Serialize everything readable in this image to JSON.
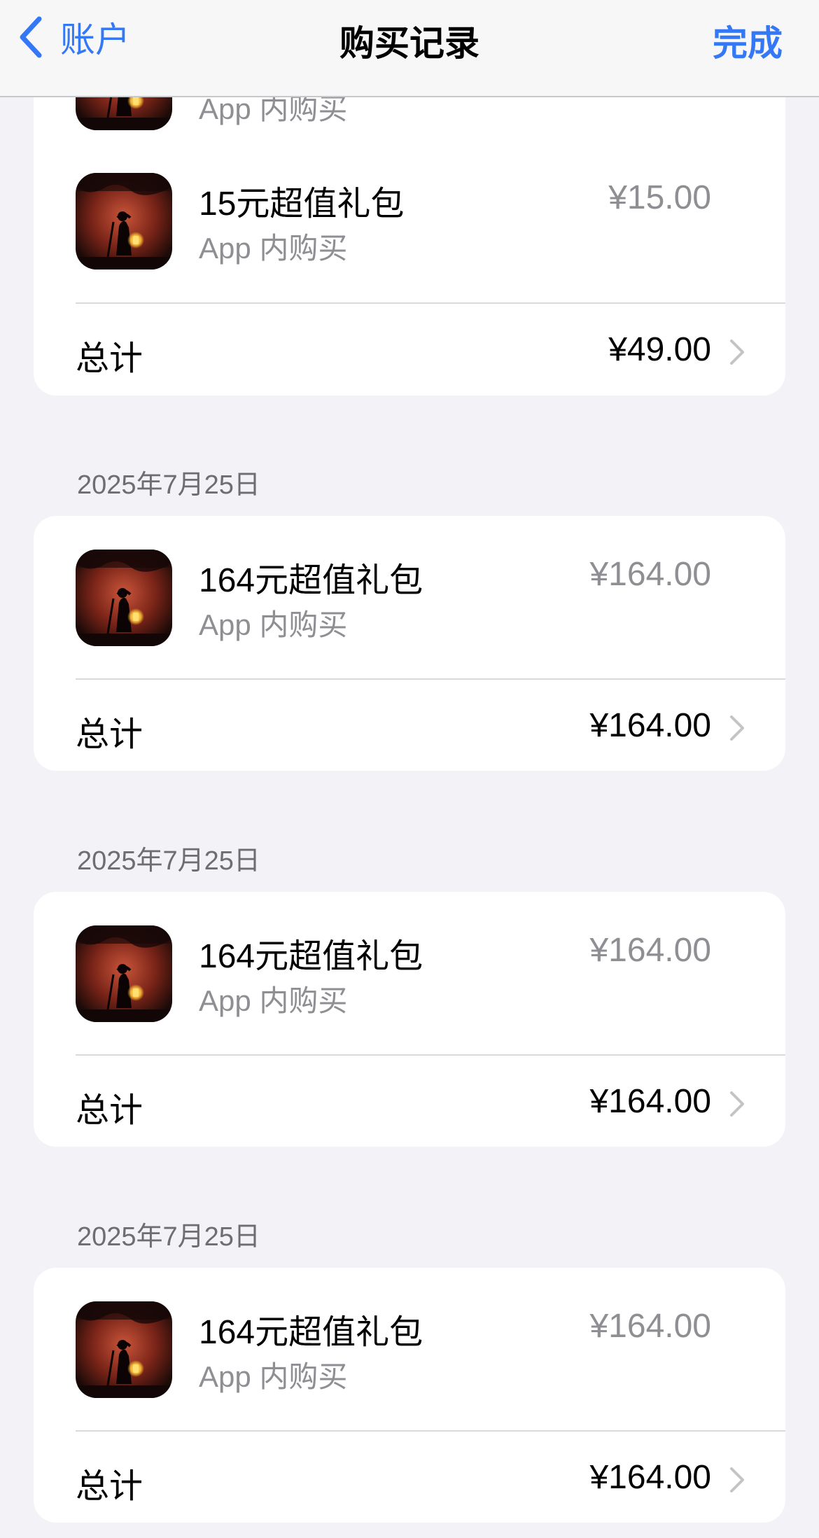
{
  "nav": {
    "back_label": "账户",
    "title": "购买记录",
    "done_label": "完成"
  },
  "group1": {
    "partial_item": {
      "subtitle": "App 内购买"
    },
    "item": {
      "title": "15元超值礼包",
      "subtitle": "App 内购买",
      "price": "¥15.00"
    },
    "total_label": "总计",
    "total_value": "¥49.00"
  },
  "group2": {
    "date": "2025年7月25日",
    "item": {
      "title": "164元超值礼包",
      "subtitle": "App 内购买",
      "price": "¥164.00"
    },
    "total_label": "总计",
    "total_value": "¥164.00"
  },
  "group3": {
    "date": "2025年7月25日",
    "item": {
      "title": "164元超值礼包",
      "subtitle": "App 内购买",
      "price": "¥164.00"
    },
    "total_label": "总计",
    "total_value": "¥164.00"
  },
  "group4": {
    "date": "2025年7月25日",
    "item": {
      "title": "164元超值礼包",
      "subtitle": "App 内购买",
      "price": "¥164.00"
    },
    "total_label": "总计",
    "total_value": "¥164.00"
  },
  "colors": {
    "accent": "#3478f6",
    "background": "#f2f2f7",
    "secondary_text": "#8e8e93"
  },
  "icons": {
    "back": "chevron-left-icon",
    "disclosure": "chevron-right-icon",
    "app": "game-app-icon"
  }
}
